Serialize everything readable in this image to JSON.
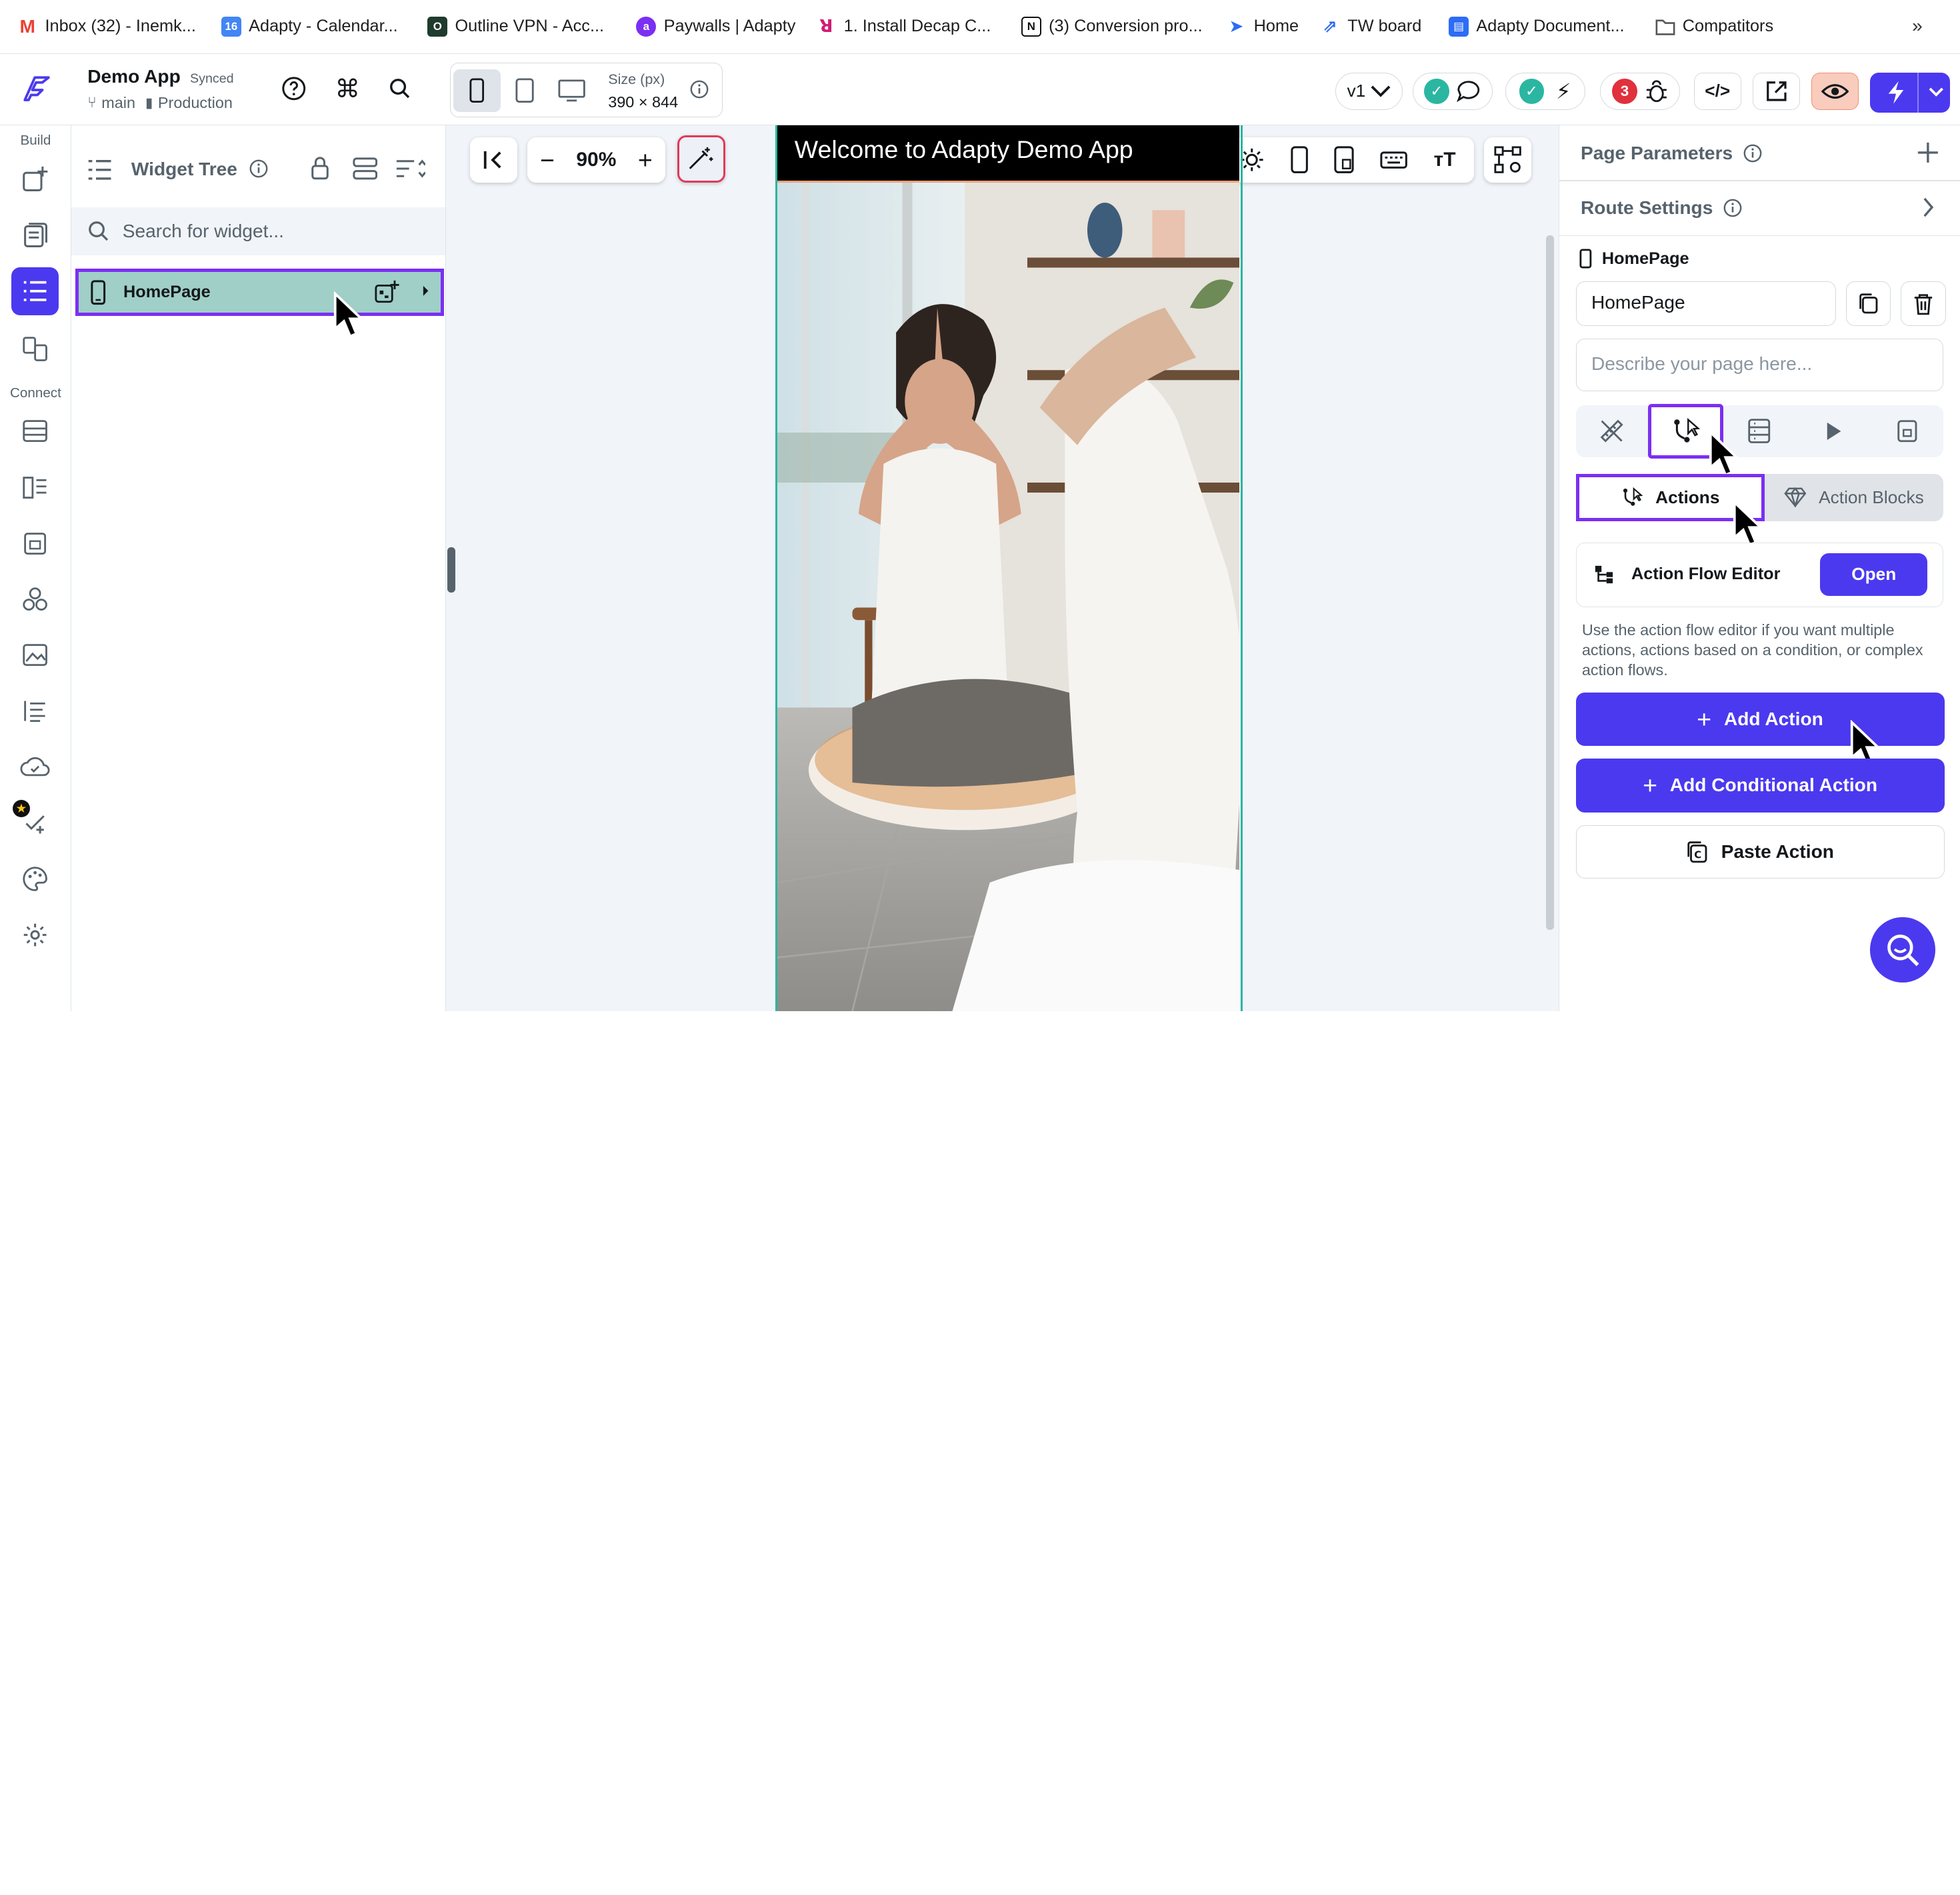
{
  "bookmarks": [
    {
      "label": "Inbox (32) - Inemk...",
      "icon": "gmail-icon",
      "color": "#ea4335"
    },
    {
      "label": "Adapty - Calendar...",
      "icon": "calendar-icon",
      "color": "#4285f4"
    },
    {
      "label": "Outline VPN - Acc...",
      "icon": "outline-icon",
      "color": "#1f3a2e"
    },
    {
      "label": "Paywalls | Adapty",
      "icon": "adapty-icon",
      "color": "#7b2ff2"
    },
    {
      "label": "1. Install Decap C...",
      "icon": "decap-icon",
      "color": "#d11c74"
    },
    {
      "label": "(3) Conversion pro...",
      "icon": "notion-icon",
      "color": "#111111"
    },
    {
      "label": "Home",
      "icon": "home-arrow-icon",
      "color": "#2d6cf6"
    },
    {
      "label": "TW board",
      "icon": "jira-icon",
      "color": "#2d6cf6"
    },
    {
      "label": "Adapty Document...",
      "icon": "docs-icon",
      "color": "#2d6cf6"
    },
    {
      "label": "Compatitors",
      "icon": "folder-icon",
      "color": "#555555"
    }
  ],
  "header": {
    "app_name": "Demo App",
    "sync_status": "Synced",
    "branch": "main",
    "environment": "Production",
    "size_label": "Size (px)",
    "size_value": "390 × 844",
    "version": "v1",
    "issue_count": "3"
  },
  "rail": {
    "build_label": "Build",
    "connect_label": "Connect"
  },
  "tree": {
    "title": "Widget Tree",
    "search_placeholder": "Search for widget...",
    "selected_page": "HomePage"
  },
  "canvas": {
    "zoom": "90%",
    "app_bar_title": "Welcome to Adapty Demo App"
  },
  "props": {
    "page_parameters": "Page Parameters",
    "route_settings": "Route Settings",
    "page_label": "HomePage",
    "page_name_value": "HomePage",
    "describe_placeholder": "Describe your page here...",
    "tab_actions": "Actions",
    "tab_action_blocks": "Action Blocks",
    "action_flow_editor": "Action Flow Editor",
    "open_label": "Open",
    "help_text": "Use the action flow editor if you want multiple actions, actions based on a condition, or complex action flows.",
    "add_action": "Add Action",
    "add_conditional_action": "Add Conditional Action",
    "paste_action": "Paste Action"
  },
  "colors": {
    "primary": "#4b39ef",
    "highlight": "#7b2ff2",
    "success": "#2bb6a2",
    "danger": "#e0313c"
  }
}
